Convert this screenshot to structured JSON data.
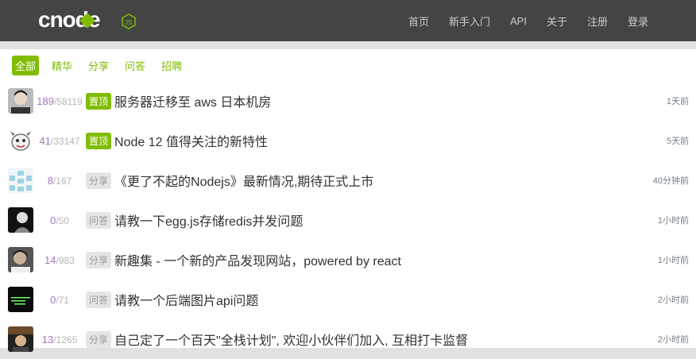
{
  "nav": {
    "logo_text": "cnode",
    "logo_badge": "JS",
    "links": [
      "首页",
      "新手入门",
      "API",
      "关于",
      "注册",
      "登录"
    ]
  },
  "tabs": [
    "全部",
    "精华",
    "分享",
    "问答",
    "招聘"
  ],
  "active_tab": "全部",
  "topics": [
    {
      "replies": "189",
      "views": "58119",
      "tag": "置顶",
      "tag_type": "top",
      "title": "服务器迁移至 aws 日本机房",
      "time": "1天前",
      "avatar_icon": "user-photo-avatar"
    },
    {
      "replies": "41",
      "views": "33147",
      "tag": "置顶",
      "tag_type": "top",
      "title": "Node 12 值得关注的新特性",
      "time": "5天前",
      "avatar_icon": "cartoon-avatar"
    },
    {
      "replies": "8",
      "views": "167",
      "tag": "分享",
      "tag_type": "plain",
      "title": "《更了不起的Nodejs》最新情况,期待正式上市",
      "time": "40分钟前",
      "avatar_icon": "identicon-avatar"
    },
    {
      "replies": "0",
      "views": "50",
      "tag": "问答",
      "tag_type": "plain",
      "title": "请教一下egg.js存储redis并发问题",
      "time": "1小时前",
      "avatar_icon": "dark-photo-avatar"
    },
    {
      "replies": "14",
      "views": "983",
      "tag": "分享",
      "tag_type": "plain",
      "title": "新趣集 - 一个新的产品发现网站，powered by react",
      "time": "1小时前",
      "avatar_icon": "user-photo-avatar"
    },
    {
      "replies": "0",
      "views": "71",
      "tag": "问答",
      "tag_type": "plain",
      "title": "请教一个后端图片api问题",
      "time": "2小时前",
      "avatar_icon": "terminal-avatar"
    },
    {
      "replies": "13",
      "views": "1265",
      "tag": "分享",
      "tag_type": "plain",
      "title": "自己定了一个百天\"全栈计划\", 欢迎小伙伴们加入, 互相打卡监督",
      "time": "2小时前",
      "avatar_icon": "dark-photo-avatar"
    }
  ]
}
